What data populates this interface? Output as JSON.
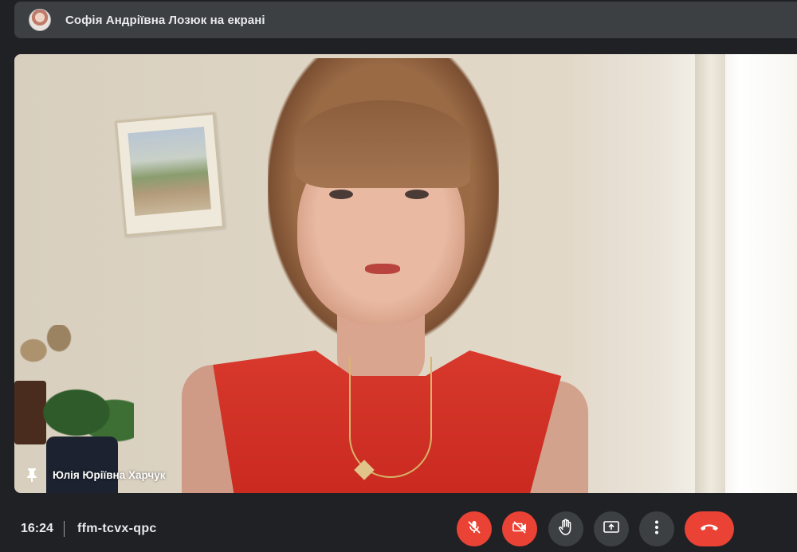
{
  "header": {
    "presenter_text": "Софія Андріївна Лозюк на екрані",
    "avatar_icon": "avatar"
  },
  "tile": {
    "participant_name": "Юлія Юріївна Харчук",
    "pin_icon": "pin-icon"
  },
  "footer": {
    "time": "16:24",
    "meeting_code": "ffm-tcvx-qpc"
  },
  "controls": {
    "items": [
      {
        "name": "microphone-off",
        "icon": "mic-off-icon"
      },
      {
        "name": "camera-off",
        "icon": "camera-off-icon"
      },
      {
        "name": "raise-hand",
        "icon": "hand-icon"
      },
      {
        "name": "present-now",
        "icon": "present-icon"
      },
      {
        "name": "more-options",
        "icon": "more-vert-icon"
      },
      {
        "name": "leave-call",
        "icon": "end-call-icon"
      }
    ]
  },
  "colors": {
    "background": "#202124",
    "bar": "#3c4043",
    "danger": "#ea4335",
    "text": "#e8eaed"
  }
}
